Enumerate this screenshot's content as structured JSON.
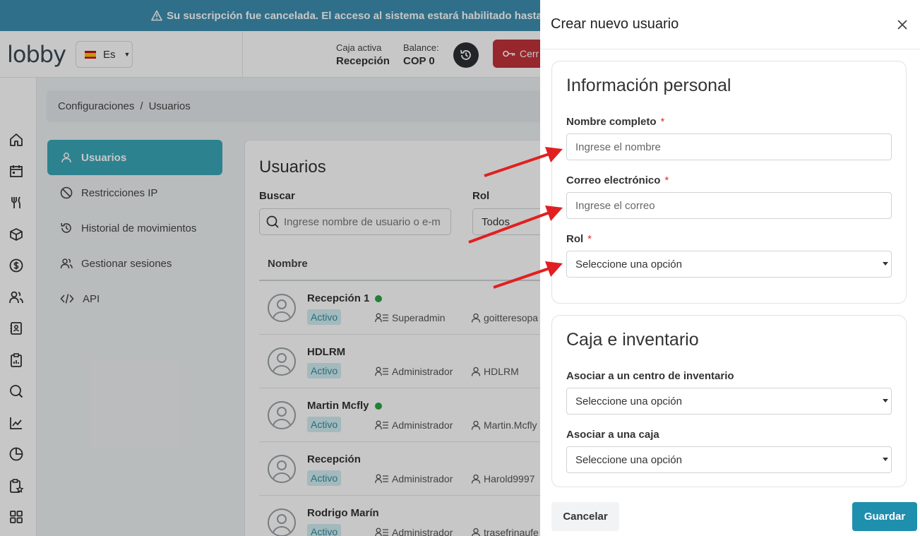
{
  "banner": {
    "text": "Su suscripción fue cancelada. El acceso al sistema estará habilitado hasta el"
  },
  "header": {
    "logo": "lobby",
    "language": "Es",
    "caja_label": "Caja activa",
    "caja_value": "Recepción",
    "balance_label": "Balance:",
    "balance_value": "COP 0",
    "cerrar_label": "Cerr"
  },
  "breadcrumb": {
    "parent": "Configuraciones",
    "separator": "/",
    "current": "Usuarios"
  },
  "settings_nav": [
    {
      "label": "Usuarios",
      "icon": "user-icon",
      "active": true
    },
    {
      "label": "Restricciones IP",
      "icon": "ban-icon",
      "active": false
    },
    {
      "label": "Historial de movimientos",
      "icon": "history-icon",
      "active": false
    },
    {
      "label": "Gestionar sesiones",
      "icon": "users-icon",
      "active": false
    },
    {
      "label": "API",
      "icon": "code-icon",
      "active": false
    }
  ],
  "users_panel": {
    "title": "Usuarios",
    "search_label": "Buscar",
    "search_placeholder": "Ingrese nombre de usuario o e-m",
    "role_label": "Rol",
    "role_value": "Todos",
    "column_name": "Nombre",
    "rows": [
      {
        "name": "Recepción 1",
        "online": true,
        "status": "Activo",
        "role": "Superadmin",
        "login": "goitteresopa"
      },
      {
        "name": "HDLRM",
        "online": false,
        "status": "Activo",
        "role": "Administrador",
        "login": "HDLRM"
      },
      {
        "name": "Martin Mcfly",
        "online": true,
        "status": "Activo",
        "role": "Administrador",
        "login": "Martin.Mcfly"
      },
      {
        "name": "Recepción",
        "online": false,
        "status": "Activo",
        "role": "Administrador",
        "login": "Harold9997"
      },
      {
        "name": "Rodrigo Marín",
        "online": false,
        "status": "Activo",
        "role": "Administrador",
        "login": "trasefrinaufe"
      }
    ]
  },
  "drawer": {
    "title": "Crear nuevo usuario",
    "personal": {
      "title": "Información personal",
      "name_label": "Nombre completo",
      "name_placeholder": "Ingrese el nombre",
      "email_label": "Correo electrónico",
      "email_placeholder": "Ingrese el correo",
      "role_label": "Rol",
      "role_value": "Seleccione una opción",
      "required_mark": "*"
    },
    "inventory": {
      "title": "Caja e inventario",
      "center_label": "Asociar a un centro de inventario",
      "center_value": "Seleccione una opción",
      "box_label": "Asociar a una caja",
      "box_value": "Seleccione una opción"
    },
    "cancel_label": "Cancelar",
    "save_label": "Guardar"
  },
  "colors": {
    "primary": "#3aa7b8",
    "save": "#1f8fae",
    "banner": "#3e8fb0",
    "danger": "#c0323a",
    "arrow": "#e02020"
  }
}
